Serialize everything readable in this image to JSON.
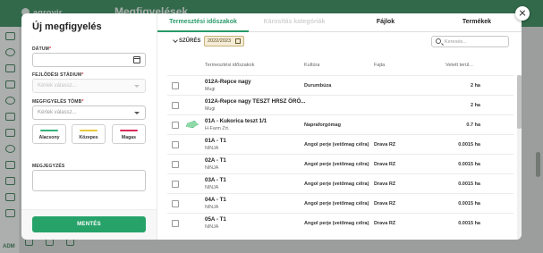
{
  "background": {
    "brand": "agrovir",
    "page_title": "Megfigyelések",
    "sidebar_footer": "ADM"
  },
  "left_panel": {
    "title": "Új megfigyelés",
    "date_label": "DÁTUM",
    "stage_label": "FEJLŐDÉSI STÁDIUM",
    "stage_placeholder": "Kérlek válassz...",
    "group_label": "MEGFIGYELÉS TÖMB",
    "group_placeholder": "Kérlek válassz...",
    "priority": [
      {
        "label": "Alacsony",
        "color": "#34b27b"
      },
      {
        "label": "Közepes",
        "color": "#e9c93a"
      },
      {
        "label": "Magas",
        "color": "#d92b5a"
      }
    ],
    "note_label": "MEGJEGYZÉS",
    "save_label": "MENTÉS"
  },
  "tabs": [
    {
      "label": "Termesztési időszakok",
      "state": "active"
    },
    {
      "label": "Károsítás kategóriák",
      "state": "disabled"
    },
    {
      "label": "Fájlok",
      "state": "normal"
    },
    {
      "label": "Termékek",
      "state": "normal"
    }
  ],
  "filter": {
    "label": "SZŰRÉS",
    "season": "2022/2023",
    "search_placeholder": "Keresés..."
  },
  "table": {
    "columns": [
      "Termesztési időszakok",
      "Kultúra",
      "Fajta",
      "Vetett terül..."
    ],
    "rows": [
      {
        "name": "012A-Repce nagy",
        "sub": "Mugi",
        "culture": "Durumbúza",
        "variety": "",
        "area": "2 ha",
        "shape": false
      },
      {
        "name": "012A-Repce nagy TESZT HRSZ ÖRÖ...",
        "sub": "Mugi",
        "culture": "",
        "variety": "",
        "area": "2 ha",
        "shape": false
      },
      {
        "name": "01A - Kukorica teszt 1/1",
        "sub": "H-Farm Zrt.",
        "culture": "Napraforgómag",
        "variety": "",
        "area": "0.7 ha",
        "shape": true
      },
      {
        "name": "01A - T1",
        "sub": "NINJA",
        "culture": "Angol perje (vetőmag célra)",
        "variety": "Drava RZ",
        "area": "0.0015 ha",
        "shape": false
      },
      {
        "name": "02A - T1",
        "sub": "NINJA",
        "culture": "Angol perje (vetőmag célra)",
        "variety": "Drava RZ",
        "area": "0.0015 ha",
        "shape": false
      },
      {
        "name": "03A - T1",
        "sub": "NINJA",
        "culture": "Angol perje (vetőmag célra)",
        "variety": "Drava RZ",
        "area": "0.0015 ha",
        "shape": false
      },
      {
        "name": "04A - T1",
        "sub": "NINJA",
        "culture": "Angol perje (vetőmag célra)",
        "variety": "Drava RZ",
        "area": "0.0015 ha",
        "shape": false
      },
      {
        "name": "05A - T1",
        "sub": "NINJA",
        "culture": "Angol perje (vetőmag célra)",
        "variety": "Drava RZ",
        "area": "0.0015 ha",
        "shape": false
      }
    ]
  }
}
